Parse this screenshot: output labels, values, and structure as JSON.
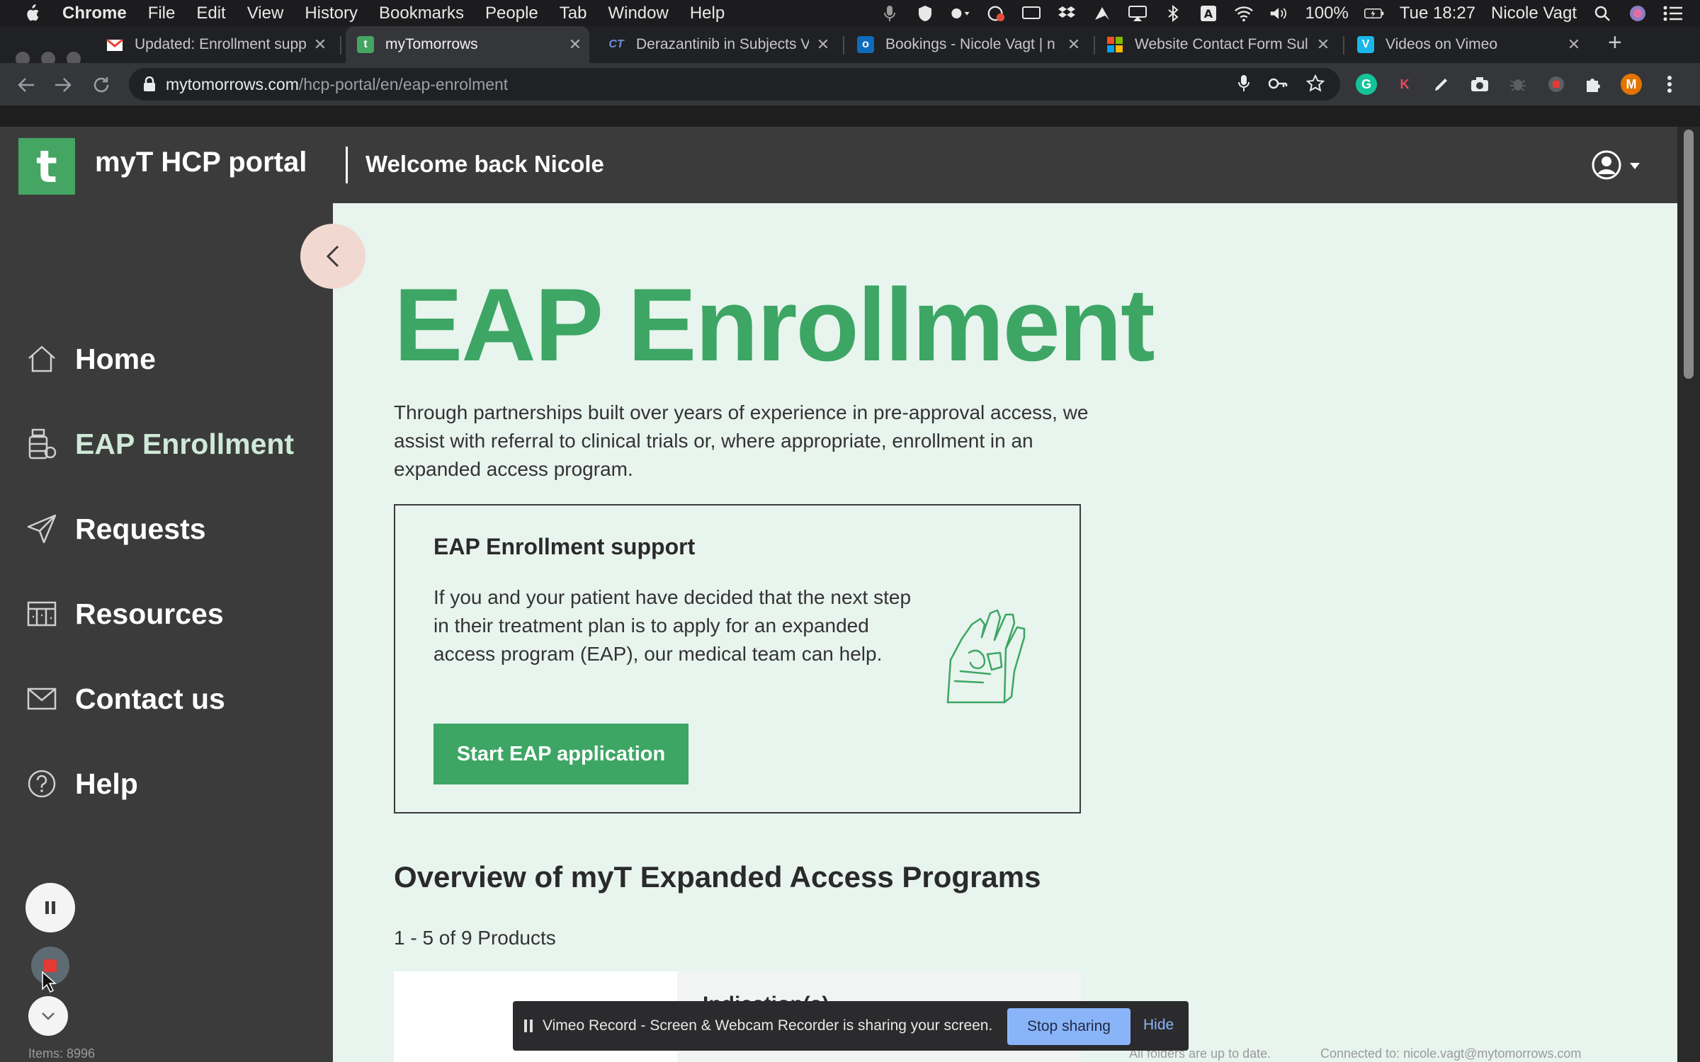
{
  "menubar": {
    "app": "Chrome",
    "items": [
      "File",
      "Edit",
      "View",
      "History",
      "Bookmarks",
      "People",
      "Tab",
      "Window",
      "Help"
    ],
    "battery": "100%",
    "clock": "Tue 18:27",
    "user": "Nicole Vagt"
  },
  "tabs": [
    {
      "title": "Updated: Enrollment supp",
      "favicon": "gmail-icon",
      "color": "#ea4335"
    },
    {
      "title": "myTomorrows",
      "favicon": "mytomorrows-icon",
      "color": "#45a563"
    },
    {
      "title": "Derazantinib in Subjects V",
      "favicon": "clinicaltrials-icon",
      "color": "#3b5998"
    },
    {
      "title": "Bookings - Nicole Vagt | n",
      "favicon": "outlook-icon",
      "color": "#0f6cbd"
    },
    {
      "title": "Website Contact Form Sul",
      "favicon": "microsoft-icon",
      "color": "#f25022"
    },
    {
      "title": "Videos on Vimeo",
      "favicon": "vimeo-icon",
      "color": "#1ab7ea"
    }
  ],
  "address": {
    "domain": "mytomorrows.com",
    "path": "/hcp-portal/en/eap-enrolment"
  },
  "extensions": [
    {
      "name": "grammarly-icon",
      "letter": "G",
      "color": "#15c39a"
    },
    {
      "name": "klarna-icon",
      "letter": "K",
      "color": "#e84a5f"
    },
    {
      "name": "profile-avatar",
      "letter": "M",
      "color": "#e37400"
    }
  ],
  "header": {
    "logo_letter": "t",
    "app_title": "myT HCP portal",
    "welcome": "Welcome back Nicole"
  },
  "sidebar": {
    "items": [
      {
        "label": "Home",
        "icon": "home-icon"
      },
      {
        "label": "EAP Enrollment",
        "icon": "eap-enrollment-icon"
      },
      {
        "label": "Requests",
        "icon": "paper-plane-icon"
      },
      {
        "label": "Resources",
        "icon": "resources-icon"
      },
      {
        "label": "Contact us",
        "icon": "envelope-icon"
      },
      {
        "label": "Help",
        "icon": "question-circle-icon"
      }
    ],
    "active_index": 1
  },
  "main": {
    "title": "EAP Enrollment",
    "intro": "Through partnerships built over years of experience in pre-approval access, we assist with referral to clinical trials or, where appropriate, enrollment in an expanded access program.",
    "support_card": {
      "title": "EAP Enrollment support",
      "body": "If you and your patient have decided that the next step in their treatment plan is to apply for an expanded access program (EAP), our medical team can help.",
      "button": "Start EAP application"
    },
    "overview_title": "Overview of myT Expanded Access Programs",
    "count_text": "1 - 5 of 9 Products",
    "product_card_label": "Indication(s)"
  },
  "sharebar": {
    "message": "Vimeo Record - Screen & Webcam Recorder is sharing your screen.",
    "stop": "Stop sharing",
    "hide": "Hide"
  },
  "status": {
    "left": "Items: 8996",
    "mid": "All folders are up to date.",
    "right": "Connected to: nicole.vagt@mytomorrows.com"
  },
  "colors": {
    "brand_green": "#3da664",
    "page_bg": "#e8f4ee",
    "sidebar_bg": "#3b3b3b"
  }
}
